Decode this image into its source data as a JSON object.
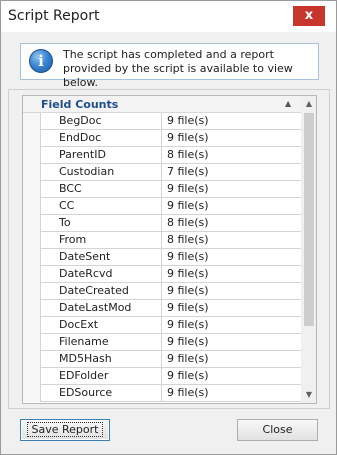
{
  "window": {
    "title": "Script Report",
    "close_glyph": "x"
  },
  "info": {
    "icon": "info-icon",
    "icon_glyph": "i",
    "message": "The script has completed and a report provided by the script is available to view below."
  },
  "report": {
    "group_label": "Field Counts",
    "rows": [
      {
        "field": "BegDoc",
        "count": "9 file(s)"
      },
      {
        "field": "EndDoc",
        "count": "9 file(s)"
      },
      {
        "field": "ParentID",
        "count": "8 file(s)"
      },
      {
        "field": "Custodian",
        "count": "7 file(s)"
      },
      {
        "field": "BCC",
        "count": "9 file(s)"
      },
      {
        "field": "CC",
        "count": "9 file(s)"
      },
      {
        "field": "To",
        "count": "8 file(s)"
      },
      {
        "field": "From",
        "count": "8 file(s)"
      },
      {
        "field": "DateSent",
        "count": "9 file(s)"
      },
      {
        "field": "DateRcvd",
        "count": "9 file(s)"
      },
      {
        "field": "DateCreated",
        "count": "9 file(s)"
      },
      {
        "field": "DateLastMod",
        "count": "9 file(s)"
      },
      {
        "field": "DocExt",
        "count": "9 file(s)"
      },
      {
        "field": "Filename",
        "count": "9 file(s)"
      },
      {
        "field": "MD5Hash",
        "count": "9 file(s)"
      },
      {
        "field": "EDFolder",
        "count": "9 file(s)"
      },
      {
        "field": "EDSource",
        "count": "9 file(s)"
      }
    ]
  },
  "buttons": {
    "save_label": "Save Report",
    "close_label": "Close"
  }
}
